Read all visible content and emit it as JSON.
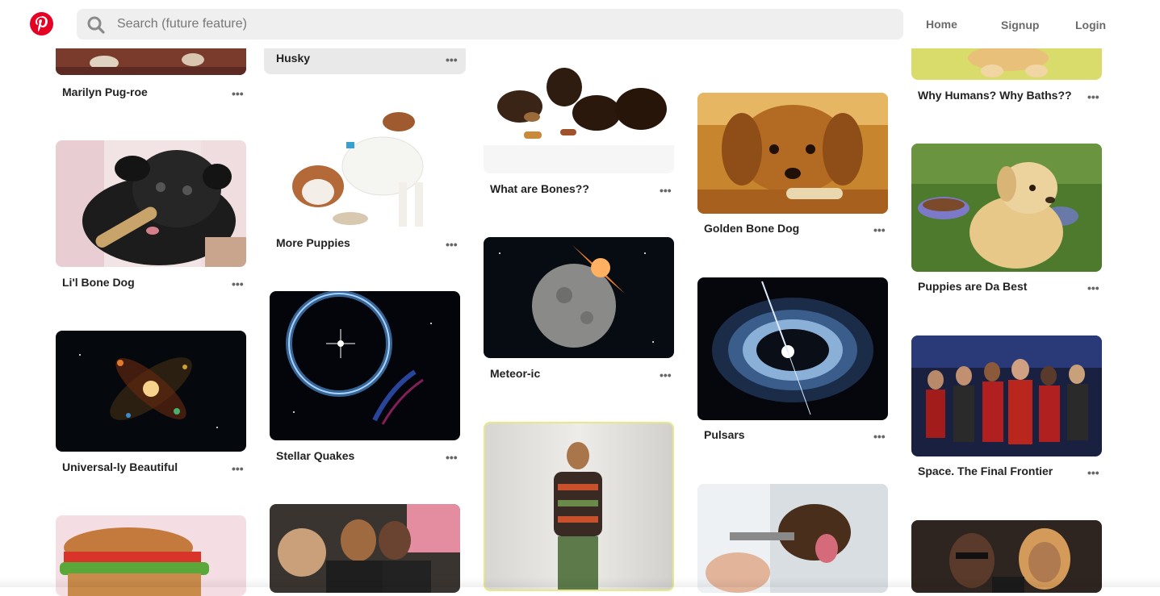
{
  "app": {
    "brand_color": "#e60023",
    "logo_icon": "pinterest-logo-icon"
  },
  "search": {
    "placeholder": "Search (future feature)",
    "icon": "search-icon"
  },
  "nav": {
    "home": "Home",
    "signup": "Signup",
    "login": "Login"
  },
  "more_icon": "ellipsis-icon",
  "pins": [
    {
      "title": "Marilyn Pug-roe",
      "more": "•••"
    },
    {
      "title": "Li'l Bone Dog",
      "more": "•••"
    },
    {
      "title": "Universal-ly Beautiful",
      "more": "•••"
    },
    {
      "title": "Husky",
      "more": "•••"
    },
    {
      "title": "More Puppies",
      "more": "•••"
    },
    {
      "title": "Stellar Quakes",
      "more": "•••"
    },
    {
      "title": "What are Bones??",
      "more": "•••"
    },
    {
      "title": "Meteor-ic",
      "more": "•••"
    },
    {
      "title": "Golden Bone Dog",
      "more": "•••"
    },
    {
      "title": "Pulsars",
      "more": "•••"
    },
    {
      "title": "Why Humans? Why Baths??",
      "more": "•••"
    },
    {
      "title": "Puppies are Da Best",
      "more": "•••"
    },
    {
      "title": "Space. The Final Frontier",
      "more": "•••"
    }
  ]
}
